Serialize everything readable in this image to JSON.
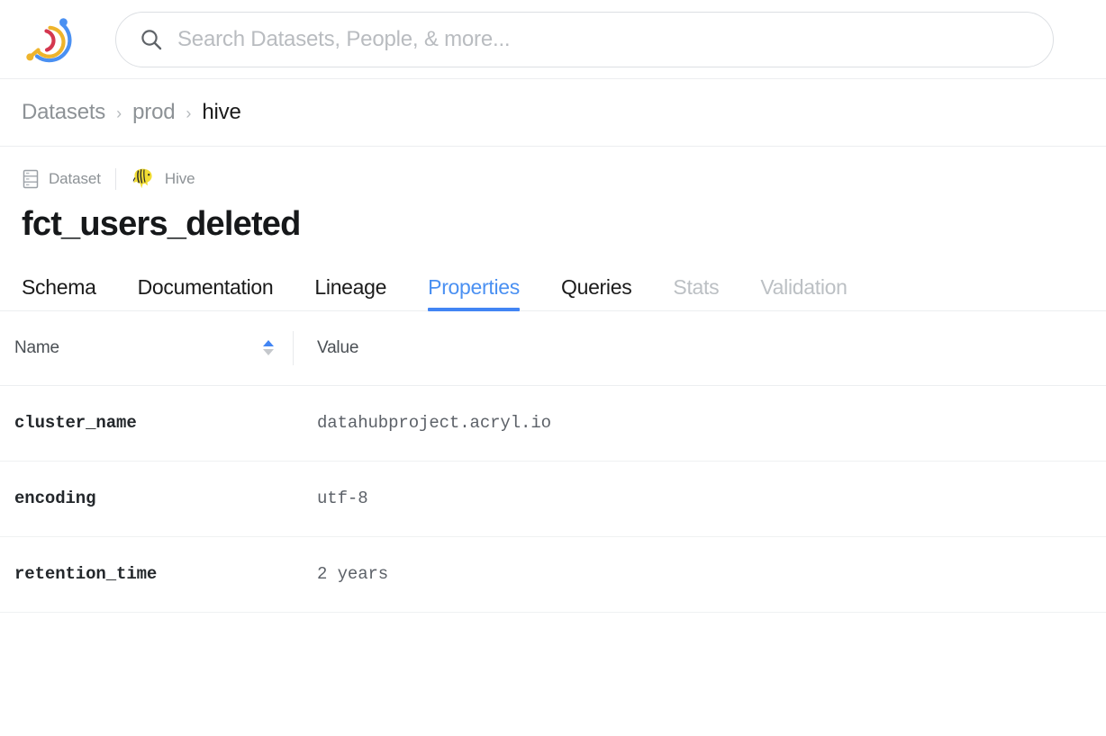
{
  "header": {
    "logo_icon": "datahub-logo-icon",
    "search": {
      "icon": "search-icon",
      "placeholder": "Search Datasets, People, & more...",
      "value": ""
    }
  },
  "breadcrumb": {
    "separator": "›",
    "items": [
      {
        "label": "Datasets",
        "current": false
      },
      {
        "label": "prod",
        "current": false
      },
      {
        "label": "hive",
        "current": true
      }
    ]
  },
  "entity": {
    "type_icon": "dataset-icon",
    "type_label": "Dataset",
    "platform_icon": "hive-logo-icon",
    "platform_label": "Hive",
    "title": "fct_users_deleted"
  },
  "tabs": [
    {
      "label": "Schema",
      "state": "default"
    },
    {
      "label": "Documentation",
      "state": "default"
    },
    {
      "label": "Lineage",
      "state": "default"
    },
    {
      "label": "Properties",
      "state": "active"
    },
    {
      "label": "Queries",
      "state": "default"
    },
    {
      "label": "Stats",
      "state": "disabled"
    },
    {
      "label": "Validation",
      "state": "disabled"
    }
  ],
  "properties_table": {
    "columns": {
      "name": "Name",
      "value": "Value"
    },
    "sort": {
      "column": "Name",
      "direction": "ascending",
      "up_icon": "caret-up-icon",
      "down_icon": "caret-down-icon"
    },
    "rows": [
      {
        "name": "cluster_name",
        "value": "datahubproject.acryl.io"
      },
      {
        "name": "encoding",
        "value": "utf-8"
      },
      {
        "name": "retention_time",
        "value": "2 years"
      }
    ]
  },
  "colors": {
    "accent_blue": "#4285f4",
    "tab_active": "#4a90f2",
    "text_primary": "#1b1b1b",
    "text_muted": "#8d9296",
    "text_disabled": "#bcc0c4",
    "border": "#eceef0",
    "hive_yellow": "#f5e03c"
  }
}
